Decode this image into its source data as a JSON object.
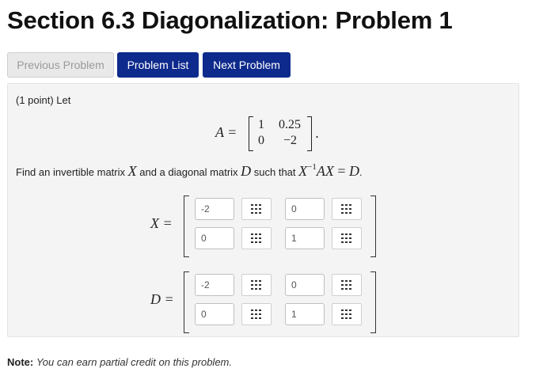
{
  "page": {
    "title": "Section 6.3 Diagonalization: Problem 1"
  },
  "nav": {
    "previous_label": "Previous Problem",
    "list_label": "Problem List",
    "next_label": "Next Problem"
  },
  "problem": {
    "intro": "(1 point) Let",
    "matrix_A": {
      "lhs": "A =",
      "cells": [
        "1",
        "0.25",
        "0",
        "−2"
      ],
      "trailing": "."
    },
    "find": {
      "part1": "Find an invertible matrix ",
      "X": "X",
      "part2": " and a diagonal matrix ",
      "D": "D",
      "part3": " such that ",
      "expr_X": "X",
      "expr_sup": "−1",
      "expr_AX": "AX",
      "expr_eq": " = ",
      "expr_D": "D",
      "end": "."
    },
    "matrix_X": {
      "label": "X =",
      "values": [
        "-2",
        "0",
        "0",
        "1"
      ]
    },
    "matrix_D": {
      "label": "D =",
      "values": [
        "-2",
        "0",
        "0",
        "1"
      ]
    }
  },
  "note": {
    "label": "Note:",
    "text": "You can earn partial credit on this problem."
  },
  "colors": {
    "primary_button": "#0e2a8c",
    "panel_bg": "#f4f4f4"
  },
  "icons": {
    "equation_editor": "matrix-grid-icon"
  }
}
